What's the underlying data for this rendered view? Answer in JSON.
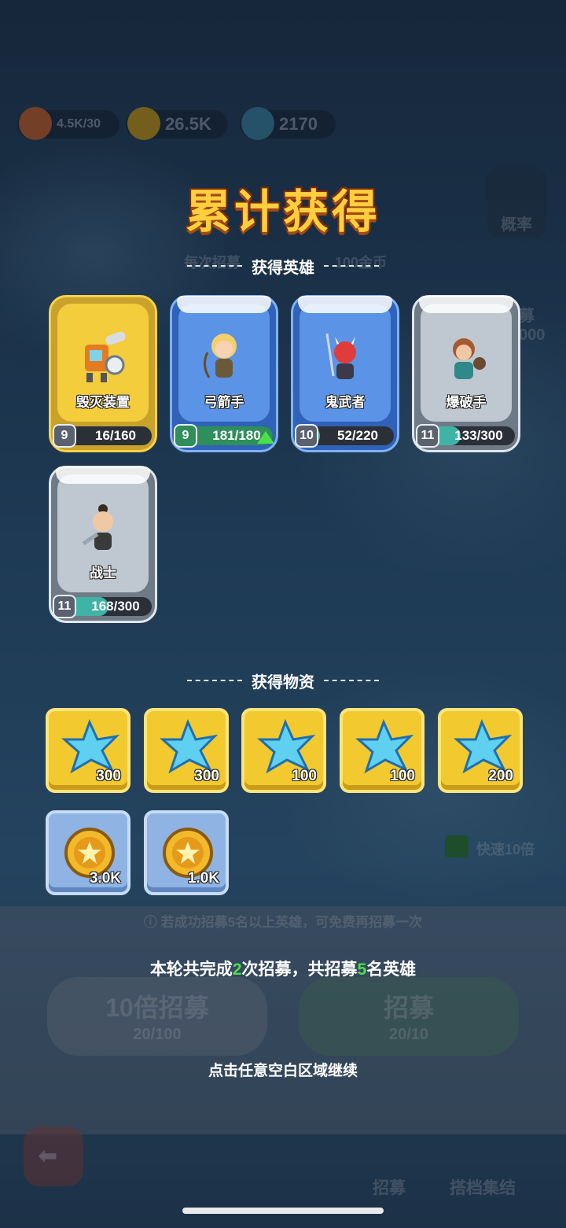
{
  "top_bar": {
    "energy": "4.5K/30",
    "coins": "26.5K",
    "crystals": "2170"
  },
  "background": {
    "banner_fragment": "每次招募",
    "banner_cost": "100金币",
    "side_probability": "概率",
    "side_recruit": "招募",
    "side_value": "000",
    "quick_toggle": "快速10倍",
    "hint": "若成功招募5名以上英雄，可免费再招募一次",
    "btn_ten_title": "10倍招募",
    "btn_ten_cost": "20/100",
    "btn_one_title": "招募",
    "btn_one_cost": "20/10",
    "nav_recruit": "招募",
    "nav_partner": "搭档集结"
  },
  "popup": {
    "title": "累计获得",
    "heroes_header": "获得英雄",
    "items_header": "获得物资",
    "summary_pre": "本轮共完成",
    "summary_times": "2",
    "summary_mid": "次招募，共招募",
    "summary_count": "5",
    "summary_post": "名英雄",
    "continue": "点击任意空白区域继续"
  },
  "heroes": [
    {
      "name": "毁灭装置",
      "level": "9",
      "count": "16/160",
      "progress": 0.1,
      "rarity": "gold"
    },
    {
      "name": "弓箭手",
      "level": "9",
      "count": "181/180",
      "progress": 1.0,
      "rarity": "blue",
      "upgrade": true
    },
    {
      "name": "鬼武者",
      "level": "10",
      "count": "52/220",
      "progress": 0.24,
      "rarity": "blue"
    },
    {
      "name": "爆破手",
      "level": "11",
      "count": "133/300",
      "progress": 0.44,
      "rarity": "gray"
    },
    {
      "name": "战士",
      "level": "11",
      "count": "168/300",
      "progress": 0.56,
      "rarity": "gray"
    }
  ],
  "items": [
    {
      "type": "crystal",
      "amount": "300"
    },
    {
      "type": "crystal",
      "amount": "300"
    },
    {
      "type": "crystal",
      "amount": "100"
    },
    {
      "type": "crystal",
      "amount": "100"
    },
    {
      "type": "crystal",
      "amount": "200"
    },
    {
      "type": "coin",
      "amount": "3.0K"
    },
    {
      "type": "coin",
      "amount": "1.0K"
    }
  ],
  "colors": {
    "gold_accent": "#ffcf3d",
    "highlight_green": "#4be04b"
  }
}
